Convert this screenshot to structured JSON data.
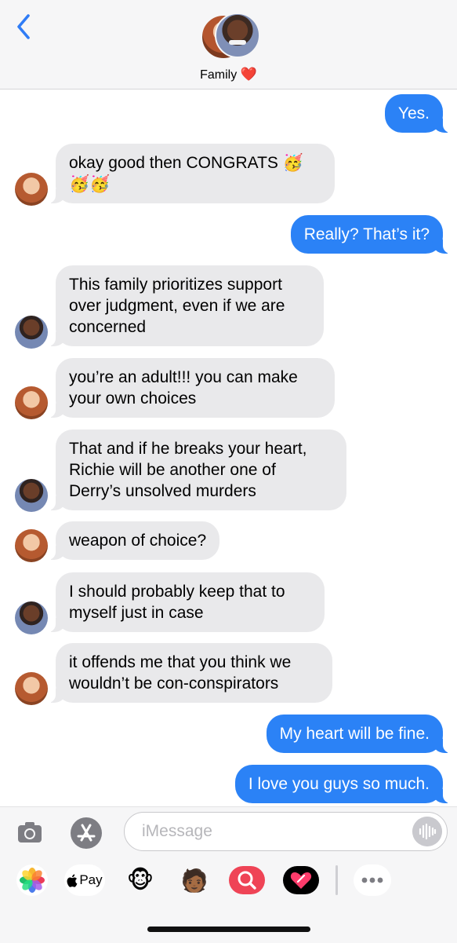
{
  "header": {
    "group_name": "Family",
    "heart": "❤️"
  },
  "messages": [
    {
      "id": "m1",
      "side": "out",
      "text": "Yes."
    },
    {
      "id": "m2",
      "side": "in",
      "sender": "woman",
      "text": "okay good then CONGRATS 🥳\n🥳🥳"
    },
    {
      "id": "m3",
      "side": "out",
      "text": "Really? That’s it?"
    },
    {
      "id": "m4",
      "side": "in",
      "sender": "man",
      "text": "This family prioritizes support\nover judgment, even if we are\nconcerned"
    },
    {
      "id": "m5",
      "side": "in",
      "sender": "woman",
      "text": "you’re an adult!!! you can make\nyour own choices"
    },
    {
      "id": "m6",
      "side": "in",
      "sender": "man",
      "text": "That and if he breaks your heart,\nRichie will be another one of\nDerry’s unsolved murders"
    },
    {
      "id": "m7",
      "side": "in",
      "sender": "woman",
      "text": "weapon of choice?"
    },
    {
      "id": "m8",
      "side": "in",
      "sender": "man",
      "text": "I should probably keep that to\nmyself just in case"
    },
    {
      "id": "m9",
      "side": "in",
      "sender": "woman",
      "text": "it offends me that you think we\nwouldn’t be con-conspirators"
    },
    {
      "id": "m10",
      "side": "out",
      "text": "My heart will be fine."
    },
    {
      "id": "m11",
      "side": "out",
      "text": "I love you guys so much."
    }
  ],
  "composer": {
    "placeholder": "iMessage"
  },
  "app_drawer": [
    {
      "id": "photos",
      "icon": "photos-icon"
    },
    {
      "id": "applepay",
      "label": "Pay",
      "icon": "apple-pay-icon"
    },
    {
      "id": "animoji",
      "icon": "monkey-icon",
      "glyph": "🐵"
    },
    {
      "id": "memoji",
      "icon": "memoji-icon",
      "glyph": "🧑🏾"
    },
    {
      "id": "images",
      "icon": "image-search-icon"
    },
    {
      "id": "digitaltouch",
      "icon": "digital-touch-icon"
    },
    {
      "id": "more",
      "icon": "more-icon"
    }
  ],
  "colors": {
    "outgoing_bubble": "#2b82f6",
    "incoming_bubble": "#e9e9eb",
    "ios_blue": "#2f7cf6"
  }
}
